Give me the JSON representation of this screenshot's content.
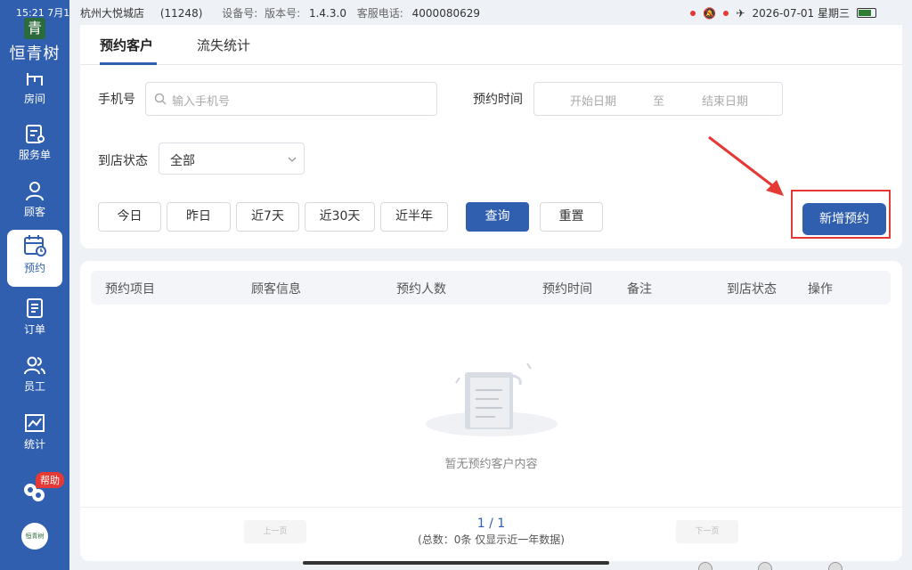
{
  "status_bar": {
    "time": "15:21",
    "date_short": "7月1",
    "store_name": "杭州大悦城店",
    "store_code": "(11248)",
    "device_label": "设备号:",
    "version_label": "版本号:",
    "version_value": "1.4.3.0",
    "service_label": "客服电话:",
    "service_phone": "4000080629",
    "date_right": "2026-07-01 星期三"
  },
  "sidebar": {
    "brand": "恒青树",
    "brand_mark": "青",
    "items": [
      {
        "label": "房间",
        "icon": "room-icon"
      },
      {
        "label": "服务单",
        "icon": "service-order-icon"
      },
      {
        "label": "顾客",
        "icon": "customer-icon"
      },
      {
        "label": "预约",
        "icon": "appointment-icon",
        "active": true
      },
      {
        "label": "订单",
        "icon": "order-icon"
      },
      {
        "label": "员工",
        "icon": "staff-icon"
      },
      {
        "label": "统计",
        "icon": "stats-icon"
      }
    ],
    "help_badge": "帮助",
    "avatar_text": "恒青树"
  },
  "tabs": [
    {
      "label": "预约客户",
      "active": true
    },
    {
      "label": "流失统计",
      "active": false
    }
  ],
  "filters": {
    "phone_label": "手机号",
    "phone_placeholder": "输入手机号",
    "time_label": "预约时间",
    "start_placeholder": "开始日期",
    "range_sep": "至",
    "end_placeholder": "结束日期",
    "status_label": "到店状态",
    "status_value": "全部"
  },
  "quick_buttons": [
    "今日",
    "昨日",
    "近7天",
    "近30天",
    "近半年"
  ],
  "actions": {
    "query": "查询",
    "reset": "重置",
    "new_appointment": "新增预约"
  },
  "table": {
    "columns": [
      "预约项目",
      "顾客信息",
      "预约人数",
      "预约时间",
      "备注",
      "到店状态",
      "操作"
    ],
    "empty_text": "暂无预约客户内容"
  },
  "pagination": {
    "prev": "上一页",
    "next": "下一页",
    "page": "1 / 1",
    "total": "(总数：0条 仅显示近一年数据)"
  },
  "colors": {
    "primary": "#2f5fae",
    "highlight": "#e53935"
  }
}
